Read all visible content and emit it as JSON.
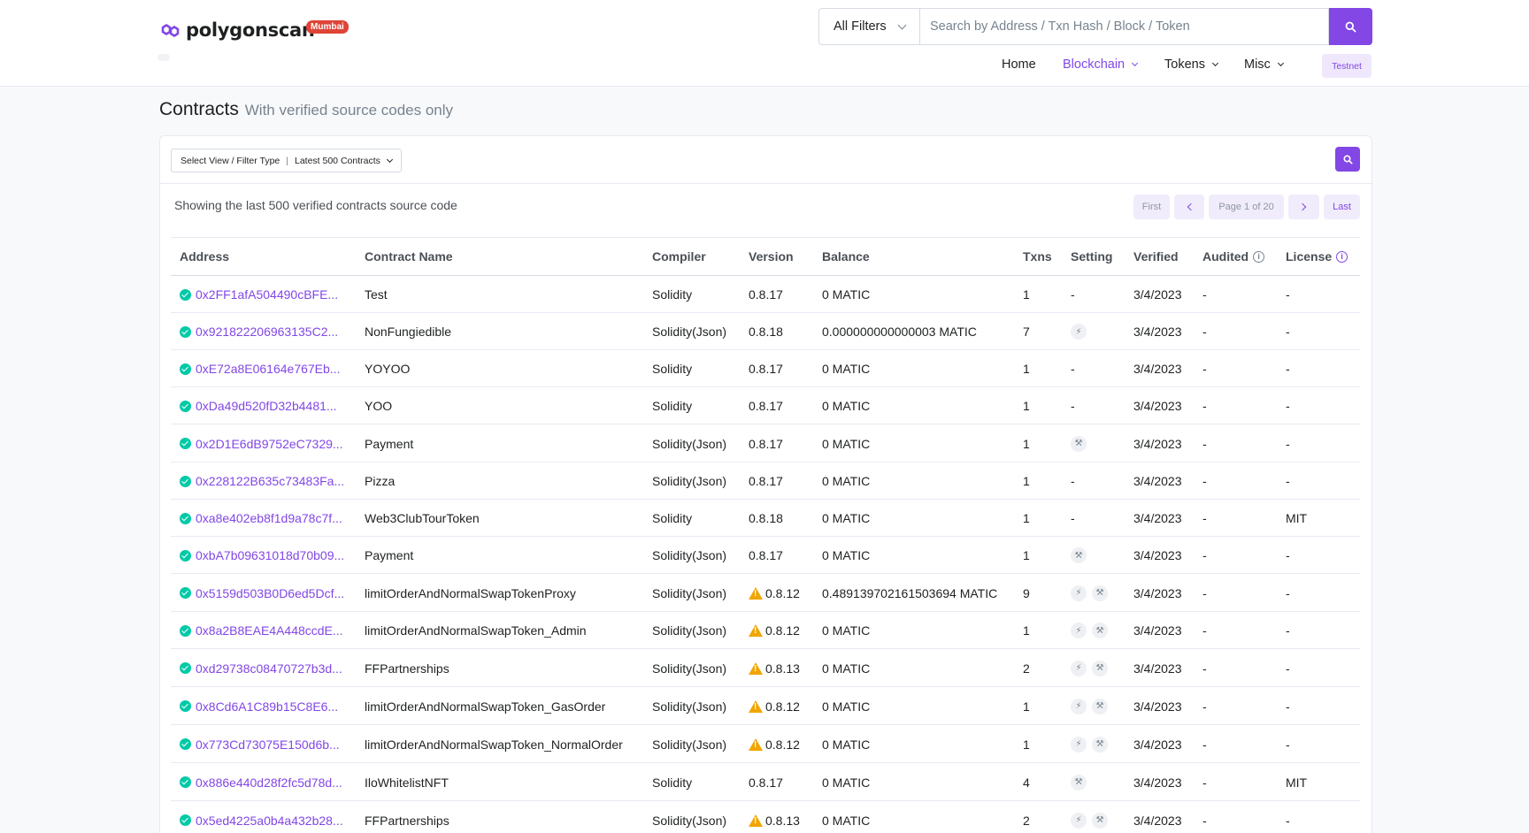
{
  "brand": {
    "name": "polygonscan",
    "network_badge": "Mumbai"
  },
  "search": {
    "filter_label": "All Filters",
    "placeholder": "Search by Address / Txn Hash / Block / Token"
  },
  "nav": {
    "home": "Home",
    "blockchain": "Blockchain",
    "tokens": "Tokens",
    "misc": "Misc",
    "testnet": "Testnet"
  },
  "page": {
    "title": "Contracts",
    "subtitle": "With verified source codes only"
  },
  "filter": {
    "label": "Select View / Filter Type",
    "value": "Latest 500 Contracts"
  },
  "showing_text": "Showing the last 500 verified contracts source code",
  "pagination": {
    "first": "First",
    "page_info": "Page 1 of 20",
    "last": "Last"
  },
  "columns": {
    "address": "Address",
    "contract_name": "Contract Name",
    "compiler": "Compiler",
    "version": "Version",
    "balance": "Balance",
    "txns": "Txns",
    "setting": "Setting",
    "verified": "Verified",
    "audited": "Audited",
    "license": "License"
  },
  "colors": {
    "accent": "#8247e5",
    "verified_check": "#00c9a7",
    "warning": "#f0a500",
    "badge_red": "#de4437"
  },
  "rows": [
    {
      "address": "0x2FF1afA504490cBFE...",
      "name": "Test",
      "compiler": "Solidity",
      "version": "0.8.17",
      "warn": false,
      "balance": "0 MATIC",
      "txns": "1",
      "setting": "-",
      "icons": [],
      "verified": "3/4/2023",
      "audited": "-",
      "license": "-"
    },
    {
      "address": "0x921822206963135C2...",
      "name": "NonFungiedible",
      "compiler": "Solidity(Json)",
      "version": "0.8.18",
      "warn": false,
      "balance": "0.000000000000003 MATIC",
      "txns": "7",
      "setting": "",
      "icons": [
        "lightning-icon"
      ],
      "verified": "3/4/2023",
      "audited": "-",
      "license": "-"
    },
    {
      "address": "0xE72a8E06164e767Eb...",
      "name": "YOYOO",
      "compiler": "Solidity",
      "version": "0.8.17",
      "warn": false,
      "balance": "0 MATIC",
      "txns": "1",
      "setting": "-",
      "icons": [],
      "verified": "3/4/2023",
      "audited": "-",
      "license": "-"
    },
    {
      "address": "0xDa49d520fD32b4481...",
      "name": "YOO",
      "compiler": "Solidity",
      "version": "0.8.17",
      "warn": false,
      "balance": "0 MATIC",
      "txns": "1",
      "setting": "-",
      "icons": [],
      "verified": "3/4/2023",
      "audited": "-",
      "license": "-"
    },
    {
      "address": "0x2D1E6dB9752eC7329...",
      "name": "Payment",
      "compiler": "Solidity(Json)",
      "version": "0.8.17",
      "warn": false,
      "balance": "0 MATIC",
      "txns": "1",
      "setting": "",
      "icons": [
        "wrench-icon"
      ],
      "verified": "3/4/2023",
      "audited": "-",
      "license": "-"
    },
    {
      "address": "0x228122B635c73483Fa...",
      "name": "Pizza",
      "compiler": "Solidity(Json)",
      "version": "0.8.17",
      "warn": false,
      "balance": "0 MATIC",
      "txns": "1",
      "setting": "-",
      "icons": [],
      "verified": "3/4/2023",
      "audited": "-",
      "license": "-"
    },
    {
      "address": "0xa8e402eb8f1d9a78c7f...",
      "name": "Web3ClubTourToken",
      "compiler": "Solidity",
      "version": "0.8.18",
      "warn": false,
      "balance": "0 MATIC",
      "txns": "1",
      "setting": "-",
      "icons": [],
      "verified": "3/4/2023",
      "audited": "-",
      "license": "MIT"
    },
    {
      "address": "0xbA7b09631018d70b09...",
      "name": "Payment",
      "compiler": "Solidity(Json)",
      "version": "0.8.17",
      "warn": false,
      "balance": "0 MATIC",
      "txns": "1",
      "setting": "",
      "icons": [
        "wrench-icon"
      ],
      "verified": "3/4/2023",
      "audited": "-",
      "license": "-"
    },
    {
      "address": "0x5159d503B0D6ed5Dcf...",
      "name": "limitOrderAndNormalSwapTokenProxy",
      "compiler": "Solidity(Json)",
      "version": "0.8.12",
      "warn": true,
      "balance": "0.489139702161503694 MATIC",
      "txns": "9",
      "setting": "",
      "icons": [
        "lightning-icon",
        "wrench-icon"
      ],
      "verified": "3/4/2023",
      "audited": "-",
      "license": "-"
    },
    {
      "address": "0x8a2B8EAE4A448ccdE...",
      "name": "limitOrderAndNormalSwapToken_Admin",
      "compiler": "Solidity(Json)",
      "version": "0.8.12",
      "warn": true,
      "balance": "0 MATIC",
      "txns": "1",
      "setting": "",
      "icons": [
        "lightning-icon",
        "wrench-icon"
      ],
      "verified": "3/4/2023",
      "audited": "-",
      "license": "-"
    },
    {
      "address": "0xd29738c08470727b3d...",
      "name": "FFPartnerships",
      "compiler": "Solidity(Json)",
      "version": "0.8.13",
      "warn": true,
      "balance": "0 MATIC",
      "txns": "2",
      "setting": "",
      "icons": [
        "lightning-icon",
        "wrench-icon"
      ],
      "verified": "3/4/2023",
      "audited": "-",
      "license": "-"
    },
    {
      "address": "0x8Cd6A1C89b15C8E6...",
      "name": "limitOrderAndNormalSwapToken_GasOrder",
      "compiler": "Solidity(Json)",
      "version": "0.8.12",
      "warn": true,
      "balance": "0 MATIC",
      "txns": "1",
      "setting": "",
      "icons": [
        "lightning-icon",
        "wrench-icon"
      ],
      "verified": "3/4/2023",
      "audited": "-",
      "license": "-"
    },
    {
      "address": "0x773Cd73075E150d6b...",
      "name": "limitOrderAndNormalSwapToken_NormalOrder",
      "compiler": "Solidity(Json)",
      "version": "0.8.12",
      "warn": true,
      "balance": "0 MATIC",
      "txns": "1",
      "setting": "",
      "icons": [
        "lightning-icon",
        "wrench-icon"
      ],
      "verified": "3/4/2023",
      "audited": "-",
      "license": "-"
    },
    {
      "address": "0x886e440d28f2fc5d78d...",
      "name": "IloWhitelistNFT",
      "compiler": "Solidity",
      "version": "0.8.17",
      "warn": false,
      "balance": "0 MATIC",
      "txns": "4",
      "setting": "",
      "icons": [
        "wrench-icon"
      ],
      "verified": "3/4/2023",
      "audited": "-",
      "license": "MIT"
    },
    {
      "address": "0x5ed4225a0b4a432b28...",
      "name": "FFPartnerships",
      "compiler": "Solidity(Json)",
      "version": "0.8.13",
      "warn": true,
      "balance": "0 MATIC",
      "txns": "2",
      "setting": "",
      "icons": [
        "lightning-icon",
        "wrench-icon"
      ],
      "verified": "3/4/2023",
      "audited": "-",
      "license": "-"
    }
  ]
}
